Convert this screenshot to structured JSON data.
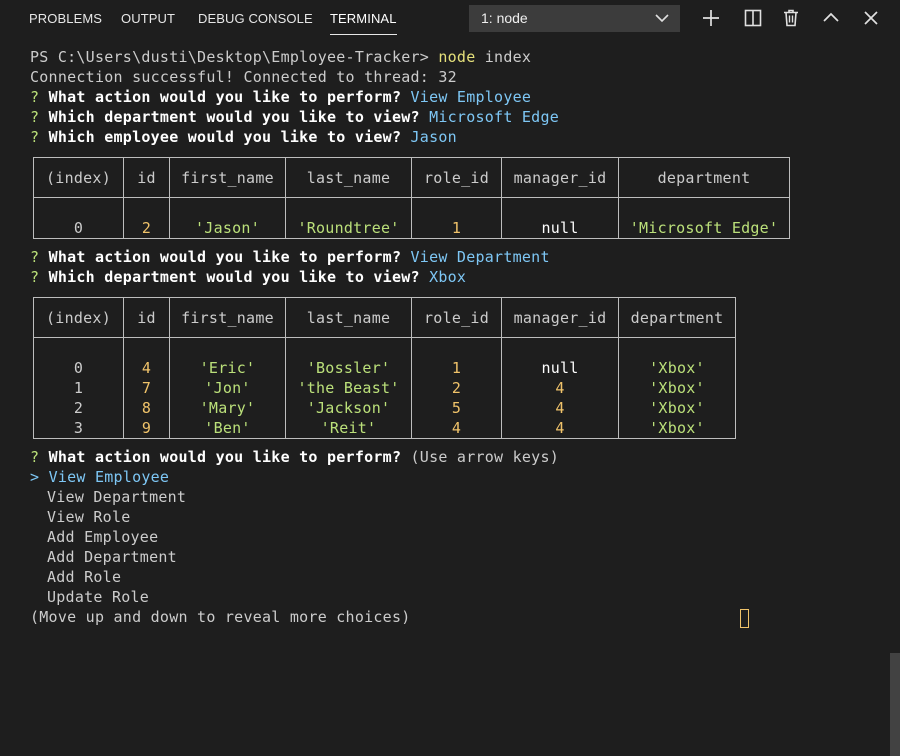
{
  "tabs": [
    "PROBLEMS",
    "OUTPUT",
    "DEBUG CONSOLE",
    "TERMINAL"
  ],
  "terminal_select": {
    "value": "1: node"
  },
  "icons": [
    "add-icon",
    "split-icon",
    "trash-icon",
    "chevron-up-icon",
    "close-icon"
  ],
  "lines": {
    "prompt_path": "PS C:\\Users\\dusti\\Desktop\\Employee-Tracker> ",
    "prompt_cmd": "node",
    "prompt_arg": " index",
    "connection": "Connection successful! Connected to thread: 32",
    "q_mark": "? ",
    "q_action": "What action would you like to perform? ",
    "a_view_employee": "View Employee",
    "q_dept": "Which department would you like to view? ",
    "a_microsoft_edge": "Microsoft Edge",
    "q_employee": "Which employee would you like to view? ",
    "a_jason": "Jason",
    "a_view_department": "View Department",
    "a_xbox": "Xbox",
    "hint_arrow_keys": "(Use arrow keys)",
    "pointer": "> ",
    "more_choices": "(Move up and down to reveal more choices)"
  },
  "menu": {
    "selected": "View Employee",
    "items": [
      "View Department",
      "View Role",
      "Add Employee",
      "Add Department",
      "Add Role",
      "Update Role"
    ]
  },
  "table1": {
    "headers": [
      "(index)",
      "id",
      "first_name",
      "last_name",
      "role_id",
      "manager_id",
      "department"
    ],
    "rows": [
      [
        "0",
        "2",
        "'Jason'",
        "'Roundtree'",
        "1",
        "null",
        "'Microsoft Edge'"
      ]
    ]
  },
  "table2": {
    "headers": [
      "(index)",
      "id",
      "first_name",
      "last_name",
      "role_id",
      "manager_id",
      "department"
    ],
    "rows": [
      [
        "0",
        "4",
        "'Eric'",
        "'Bossler'",
        "1",
        "null",
        "'Xbox'"
      ],
      [
        "1",
        "7",
        "'Jon'",
        "'the Beast'",
        "2",
        "4",
        "'Xbox'"
      ],
      [
        "2",
        "8",
        "'Mary'",
        "'Jackson'",
        "5",
        "4",
        "'Xbox'"
      ],
      [
        "3",
        "9",
        "'Ben'",
        "'Reit'",
        "4",
        "4",
        "'Xbox'"
      ]
    ]
  },
  "colors": {
    "background": "#1e1e1e",
    "answer": "#7ec7f5",
    "string": "#bbe07a",
    "number": "#f0c36a",
    "command": "#e5e07a"
  }
}
